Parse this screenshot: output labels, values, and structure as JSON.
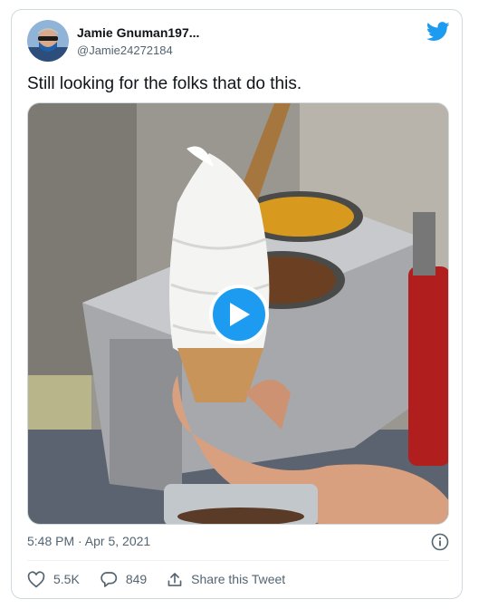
{
  "author": {
    "name": "Jamie Gnuman197...",
    "handle": "@Jamie24272184"
  },
  "tweet": {
    "text": "Still looking for the folks that do this.",
    "timestamp": "5:48 PM · Apr 5, 2021"
  },
  "media": {
    "type": "video",
    "description_icon": "play-icon"
  },
  "actions": {
    "likes": "5.5K",
    "replies": "849",
    "share_label": "Share this Tweet"
  },
  "colors": {
    "brand": "#1d9bf0",
    "text": "#0f1419",
    "muted": "#536471",
    "border": "#cfd9de"
  },
  "icons": [
    "twitter-bird-icon",
    "play-icon",
    "info-icon",
    "heart-icon",
    "reply-icon",
    "share-icon"
  ]
}
